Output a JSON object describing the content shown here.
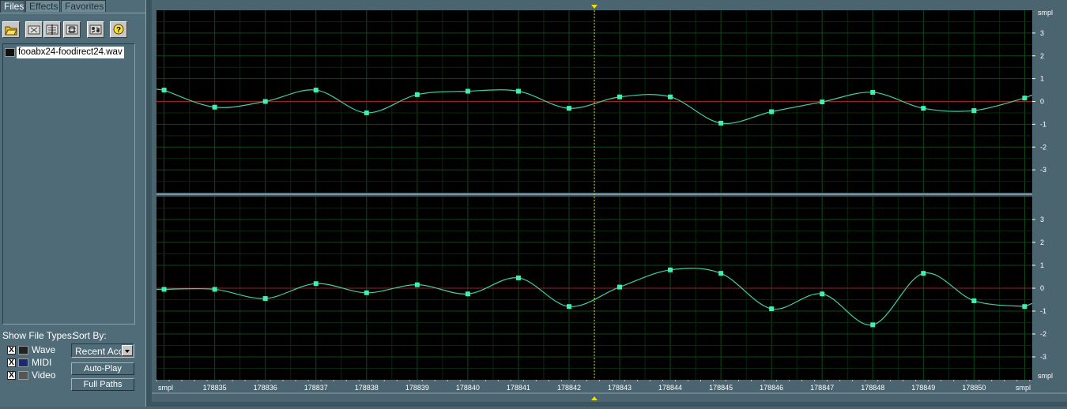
{
  "tabs": [
    {
      "label": "Files"
    },
    {
      "label": "Effects"
    },
    {
      "label": "Favorites"
    }
  ],
  "toolbar_icons": [
    "open-folder-icon",
    "close-file-icon",
    "insert-icon",
    "multitrack-icon",
    "batch-icon",
    "help-icon"
  ],
  "file_list": {
    "items": [
      {
        "name": "fooabx24-foodirect24.wav"
      }
    ]
  },
  "show_file_types": {
    "label": "Show File Types:",
    "types": [
      {
        "label": "Wave",
        "checked": true
      },
      {
        "label": "MIDI",
        "checked": true
      },
      {
        "label": "Video",
        "checked": true
      }
    ]
  },
  "sort_by": {
    "label": "Sort By:",
    "value": "Recent Acc"
  },
  "buttons": {
    "autoplay": "Auto-Play",
    "fullpaths": "Full Paths"
  },
  "colors": {
    "wave": "#3ed0a0",
    "sample": "#40f0b0",
    "zero": "#a02020",
    "grid": "#0e4a1a",
    "bg": "#000000",
    "cursor": "#f0e000"
  },
  "waveform": {
    "cursor_x": 178842.5,
    "ruler": {
      "start_label": "smpl",
      "end_label": "smpl",
      "labels": [
        "178835",
        "178836",
        "178837",
        "178838",
        "178839",
        "178840",
        "178841",
        "178842",
        "178843",
        "178844",
        "178845",
        "178846",
        "178847",
        "178848",
        "178849",
        "178850"
      ]
    },
    "y_scale": {
      "unit": "smpl",
      "labels": [
        "3",
        "2",
        "1",
        "0",
        "-1",
        "-2",
        "-3"
      ]
    },
    "chart_data": {
      "type": "line",
      "x_start": 178834,
      "x_range": [
        178833.85,
        178851.15
      ],
      "y_range": [
        -4,
        4
      ],
      "series": [
        {
          "values": [
            0.5,
            -0.25,
            0.0,
            0.5,
            -0.5,
            0.3,
            0.45,
            0.45,
            -0.3,
            0.2,
            0.2,
            -0.95,
            -0.45,
            -0.02,
            0.4,
            -0.3,
            -0.4,
            0.15
          ]
        },
        {
          "values": [
            -0.05,
            -0.05,
            -0.45,
            0.2,
            -0.2,
            0.15,
            -0.25,
            0.45,
            -0.8,
            0.05,
            0.8,
            0.65,
            -0.9,
            -0.25,
            -1.6,
            0.65,
            -0.55,
            -0.8
          ]
        }
      ]
    }
  }
}
